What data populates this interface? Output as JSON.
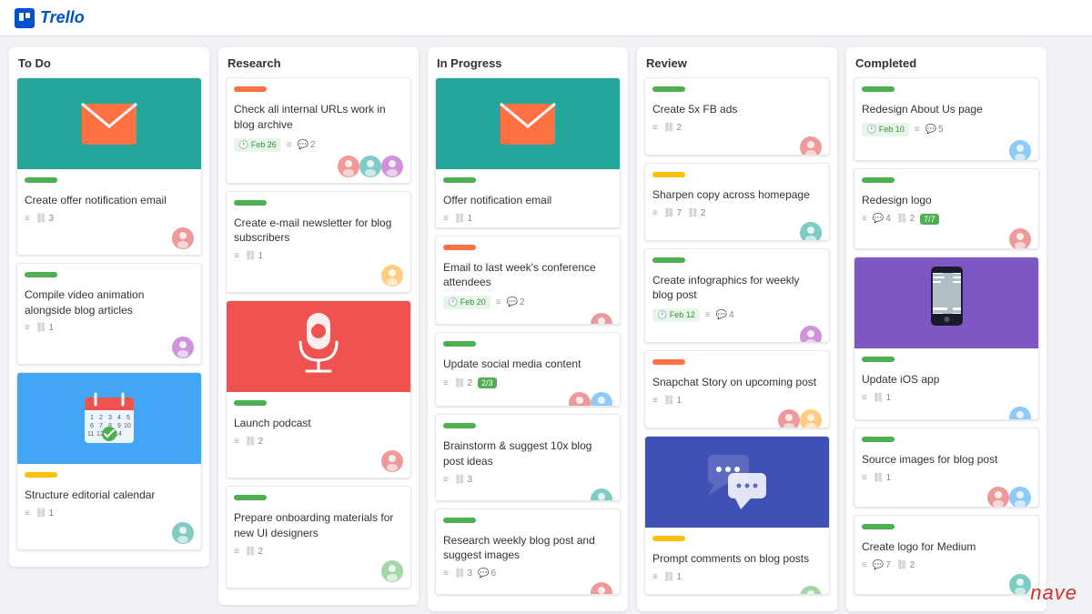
{
  "app": {
    "name": "Trello",
    "logo_text": "Trello"
  },
  "columns": [
    {
      "id": "todo",
      "title": "To Do",
      "cards": [
        {
          "id": "card-1",
          "image_type": "envelope",
          "image_bg": "#26a69a",
          "label_color": "green",
          "title": "Create offer notification email",
          "meta": [
            {
              "icon": "☰",
              "value": ""
            },
            {
              "icon": "🔗",
              "value": "3"
            }
          ],
          "avatar_color": "#ef9a9a",
          "avatar_count": 1
        },
        {
          "id": "card-2",
          "image_type": "none",
          "label_color": "green",
          "title": "Compile video animation alongside blog articles",
          "meta": [
            {
              "icon": "☰",
              "value": ""
            },
            {
              "icon": "🔗",
              "value": "1"
            }
          ],
          "avatar_color": "#ce93d8",
          "avatar_count": 1
        },
        {
          "id": "card-3",
          "image_type": "calendar",
          "image_bg": "#42a5f5",
          "label_color": "yellow",
          "title": "Structure editorial calendar",
          "meta": [
            {
              "icon": "☰",
              "value": ""
            },
            {
              "icon": "🔗",
              "value": "1"
            }
          ],
          "avatar_color": "#80cbc4",
          "avatar_count": 1
        }
      ]
    },
    {
      "id": "research",
      "title": "Research",
      "cards": [
        {
          "id": "card-4",
          "image_type": "none",
          "label_color": "orange",
          "title": "Check all internal URLs work in blog archive",
          "date": "Feb 26",
          "meta": [
            {
              "icon": "☰",
              "value": ""
            },
            {
              "icon": "💬",
              "value": "2"
            }
          ],
          "avatar_colors": [
            "#ef9a9a",
            "#80cbc4",
            "#ce93d8"
          ],
          "avatar_count": 3
        },
        {
          "id": "card-5",
          "image_type": "none",
          "label_color": "green",
          "title": "Create e-mail newsletter for blog subscribers",
          "meta": [
            {
              "icon": "☰",
              "value": ""
            },
            {
              "icon": "🔗",
              "value": "1"
            }
          ],
          "avatar_color": "#ffcc80",
          "avatar_count": 1
        },
        {
          "id": "card-6",
          "image_type": "mic",
          "image_bg": "#ef5350",
          "label_color": "green",
          "title": "Launch podcast",
          "meta": [
            {
              "icon": "☰",
              "value": ""
            },
            {
              "icon": "🔗",
              "value": "2"
            }
          ],
          "avatar_color": "#ef9a9a",
          "avatar_count": 1
        },
        {
          "id": "card-7",
          "image_type": "none",
          "label_color": "green",
          "title": "Prepare onboarding materials for new UI designers",
          "meta": [
            {
              "icon": "☰",
              "value": ""
            },
            {
              "icon": "🔗",
              "value": "2"
            }
          ],
          "avatar_color": "#a5d6a7",
          "avatar_count": 1
        }
      ]
    },
    {
      "id": "inprogress",
      "title": "In Progress",
      "cards": [
        {
          "id": "card-8",
          "image_type": "email",
          "image_bg": "#26a69a",
          "label_color": "green",
          "title": "Offer notification email",
          "meta": [
            {
              "icon": "☰",
              "value": ""
            },
            {
              "icon": "🔗",
              "value": "1"
            }
          ],
          "avatar_color": "#90caf9",
          "avatar_count": 1
        },
        {
          "id": "card-9",
          "image_type": "none",
          "label_color": "orange",
          "title": "Email to last week's conference attendees",
          "date": "Feb 20",
          "meta": [
            {
              "icon": "☰",
              "value": ""
            },
            {
              "icon": "💬",
              "value": "2"
            }
          ],
          "avatar_color": "#ef9a9a",
          "avatar_count": 1
        },
        {
          "id": "card-10",
          "image_type": "none",
          "label_color": "green",
          "title": "Update social media content",
          "meta": [
            {
              "icon": "☰",
              "value": ""
            },
            {
              "icon": "🔗",
              "value": "2"
            },
            {
              "icon": "📋",
              "value": "2/3"
            }
          ],
          "avatar_colors": [
            "#ef9a9a",
            "#90caf9"
          ],
          "avatar_count": 2
        },
        {
          "id": "card-11",
          "image_type": "none",
          "label_color": "green",
          "title": "Brainstorm & suggest 10x blog post ideas",
          "meta": [
            {
              "icon": "☰",
              "value": ""
            },
            {
              "icon": "🔗",
              "value": "3"
            }
          ],
          "avatar_color": "#80cbc4",
          "avatar_count": 1
        },
        {
          "id": "card-12",
          "image_type": "none",
          "label_color": "green",
          "title": "Research weekly blog post and suggest images",
          "meta": [
            {
              "icon": "☰",
              "value": ""
            },
            {
              "icon": "🔗",
              "value": "3"
            },
            {
              "icon": "💬",
              "value": "6"
            }
          ],
          "avatar_color": "#ef9a9a",
          "avatar_count": 1
        }
      ]
    },
    {
      "id": "review",
      "title": "Review",
      "cards": [
        {
          "id": "card-13",
          "image_type": "none",
          "label_color": "green",
          "title": "Create 5x FB ads",
          "meta": [
            {
              "icon": "☰",
              "value": ""
            },
            {
              "icon": "🔗",
              "value": "2"
            }
          ],
          "avatar_color": "#ef9a9a",
          "avatar_count": 1
        },
        {
          "id": "card-14",
          "image_type": "none",
          "label_color": "yellow",
          "title": "Sharpen copy across homepage",
          "meta": [
            {
              "icon": "☰",
              "value": ""
            },
            {
              "icon": "🔗",
              "value": "7"
            },
            {
              "icon": "🔗",
              "value": "2"
            }
          ],
          "avatar_color": "#80cbc4",
          "avatar_count": 1
        },
        {
          "id": "card-15",
          "image_type": "none",
          "label_color": "green",
          "title": "Create infographics for weekly blog post",
          "date": "Feb 12",
          "meta": [
            {
              "icon": "☰",
              "value": ""
            },
            {
              "icon": "💬",
              "value": "4"
            }
          ],
          "avatar_color": "#ce93d8",
          "avatar_count": 1
        },
        {
          "id": "card-16",
          "image_type": "none",
          "label_color": "orange",
          "title": "Snapchat Story on upcoming post",
          "meta": [
            {
              "icon": "☰",
              "value": ""
            },
            {
              "icon": "🔗",
              "value": "1"
            }
          ],
          "avatar_colors": [
            "#ef9a9a",
            "#ffcc80"
          ],
          "avatar_count": 2
        },
        {
          "id": "card-17",
          "image_type": "chat",
          "image_bg": "#3f51b5",
          "label_color": "yellow",
          "title": "Prompt comments on blog posts",
          "meta": [
            {
              "icon": "☰",
              "value": ""
            },
            {
              "icon": "🔗",
              "value": "1"
            }
          ],
          "avatar_color": "#a5d6a7",
          "avatar_count": 1
        }
      ]
    },
    {
      "id": "completed",
      "title": "Completed",
      "cards": [
        {
          "id": "card-18",
          "image_type": "none",
          "label_color": "green",
          "title": "Redesign About Us page",
          "date": "Feb 10",
          "meta": [
            {
              "icon": "☰",
              "value": ""
            },
            {
              "icon": "💬",
              "value": "5"
            }
          ],
          "avatar_color": "#90caf9",
          "avatar_count": 1
        },
        {
          "id": "card-19",
          "image_type": "none",
          "label_color": "green",
          "title": "Redesign logo",
          "meta": [
            {
              "icon": "☰",
              "value": ""
            },
            {
              "icon": "💬",
              "value": "4"
            },
            {
              "icon": "🔗",
              "value": "2"
            },
            {
              "icon": "📋",
              "value": "7/7"
            }
          ],
          "avatar_color": "#ef9a9a",
          "avatar_count": 1
        },
        {
          "id": "card-20",
          "image_type": "phone",
          "image_bg": "#7e57c2",
          "label_color": "green",
          "title": "Update iOS app",
          "meta": [
            {
              "icon": "☰",
              "value": ""
            },
            {
              "icon": "🔗",
              "value": "1"
            }
          ],
          "avatar_color": "#90caf9",
          "avatar_count": 1
        },
        {
          "id": "card-21",
          "image_type": "none",
          "label_color": "green",
          "title": "Source images for blog post",
          "meta": [
            {
              "icon": "☰",
              "value": ""
            },
            {
              "icon": "🔗",
              "value": "1"
            }
          ],
          "avatar_colors": [
            "#ef9a9a",
            "#90caf9"
          ],
          "avatar_count": 2
        },
        {
          "id": "card-22",
          "image_type": "none",
          "label_color": "green",
          "title": "Create logo for Medium",
          "meta": [
            {
              "icon": "☰",
              "value": ""
            },
            {
              "icon": "💬",
              "value": "7"
            },
            {
              "icon": "🔗",
              "value": "2"
            }
          ],
          "avatar_color": "#80cbc4",
          "avatar_count": 1
        }
      ]
    }
  ]
}
